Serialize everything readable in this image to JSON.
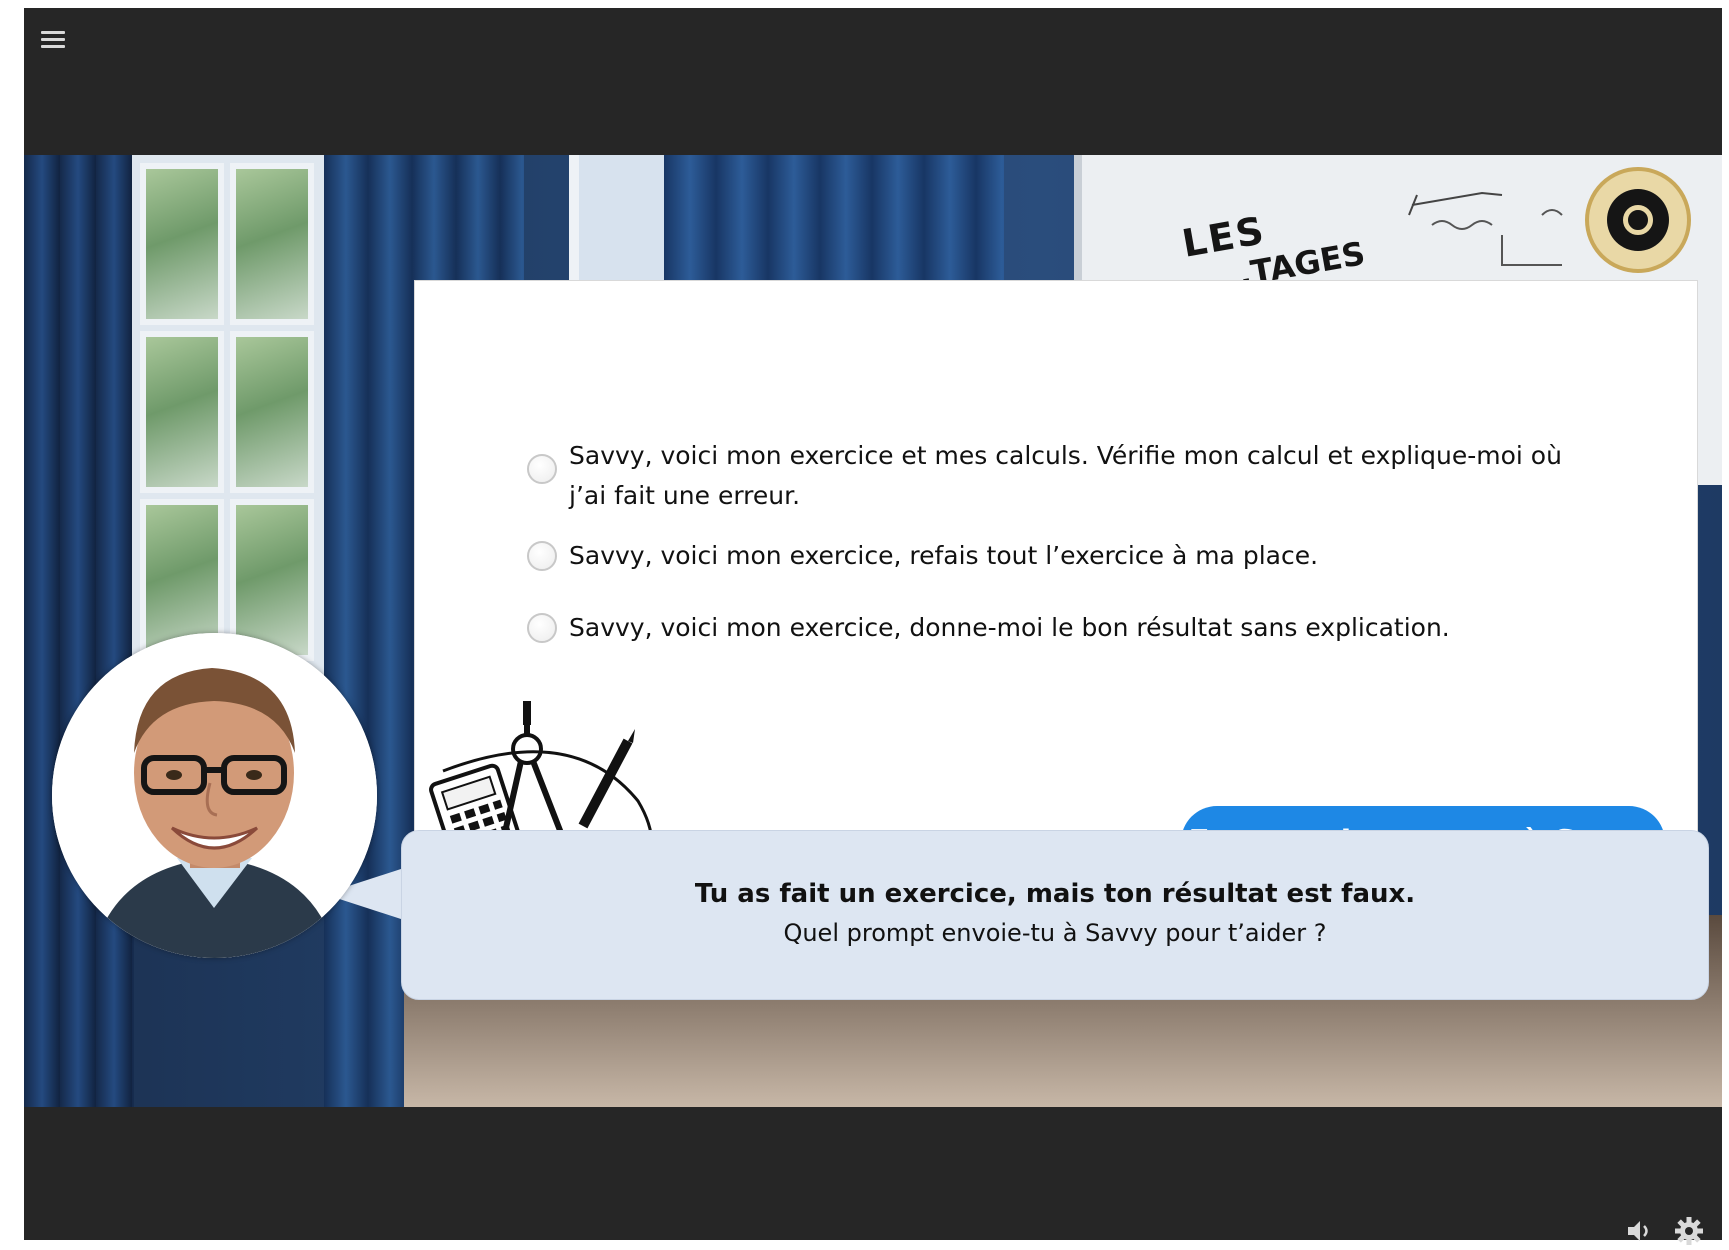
{
  "toolbar": {
    "menu_icon": "hamburger-menu-icon"
  },
  "scene": {
    "whiteboard_text_1": "LES",
    "whiteboard_text_2": "...TAGES"
  },
  "quiz": {
    "options": [
      {
        "label": "Savvy, voici mon exercice et mes calculs. Vérifie mon calcul et explique-moi où j’ai fait une erreur.",
        "selected": false
      },
      {
        "label": "Savvy, voici mon exercice, refais tout l’exercice à ma place.",
        "selected": false
      },
      {
        "label": "Savvy, voici mon exercice, donne-moi le bon résultat sans explication.",
        "selected": false
      }
    ],
    "submit_label": "Envoyer le prompt à Savvy"
  },
  "dialogue": {
    "title": "Tu as fait un exercice, mais ton résultat est faux.",
    "subtitle": "Quel prompt envoie-tu à Savvy pour t’aider ?"
  },
  "footer": {
    "volume_icon": "volume-icon",
    "settings_icon": "gear-icon"
  },
  "colors": {
    "accent": "#1e88e5",
    "bubble": "#dde6f2",
    "frame": "#262626"
  }
}
